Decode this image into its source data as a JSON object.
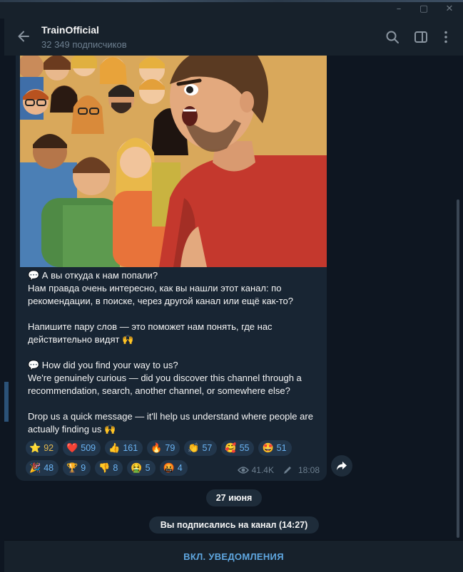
{
  "window": {
    "minimize_icon": "minimize-icon",
    "maximize_icon": "maximize-icon",
    "close_icon": "close-icon"
  },
  "header": {
    "title": "TrainOfficial",
    "subtitle": "32 349 подписчиков",
    "back_icon": "arrow-left-icon",
    "search_icon": "search-icon",
    "sidebar_icon": "sidebar-toggle-icon",
    "menu_icon": "more-vertical-icon"
  },
  "message": {
    "lines_ru": [
      "💬 А вы откуда к нам попали?",
      "Нам правда очень интересно, как вы нашли этот канал: по",
      "рекомендации, в поиске, через другой канал или ещё как-то?",
      "",
      "Напишите пару слов — это поможет нам понять, где нас",
      "действительно видят 🙌",
      "",
      "💬 How did you find your way to us?",
      "We're genuinely curious — did you discover this channel through a",
      "recommendation, search, another channel, or somewhere else?",
      "",
      "Drop us a quick message — it'll help us understand where people are",
      "actually finding us 🙌"
    ],
    "reactions_row1": [
      {
        "emoji": "⭐",
        "count": "92"
      },
      {
        "emoji": "❤️",
        "count": "509"
      },
      {
        "emoji": "👍",
        "count": "161"
      },
      {
        "emoji": "🔥",
        "count": "79"
      },
      {
        "emoji": "👏",
        "count": "57"
      },
      {
        "emoji": "🥰",
        "count": "55"
      },
      {
        "emoji": "🤩",
        "count": "51"
      }
    ],
    "reactions_row2": [
      {
        "emoji": "🎉",
        "count": "48"
      },
      {
        "emoji": "🏆",
        "count": "9"
      },
      {
        "emoji": "👎",
        "count": "8"
      },
      {
        "emoji": "🤮",
        "count": "5"
      },
      {
        "emoji": "🤬",
        "count": "4"
      }
    ],
    "views": "41.4K",
    "time": "18:08",
    "share_icon": "share-arrow-icon"
  },
  "date_pill": "27 июня",
  "service_message": "Вы подписались на канал (14:27)",
  "bottom_button": "ВКЛ. УВЕДОМЛЕНИЯ",
  "colors": {
    "background": "#0e1621",
    "panel": "#17212b",
    "bubble": "#182533",
    "accent": "#6ab3f3",
    "star_gold": "#e5b94e"
  }
}
